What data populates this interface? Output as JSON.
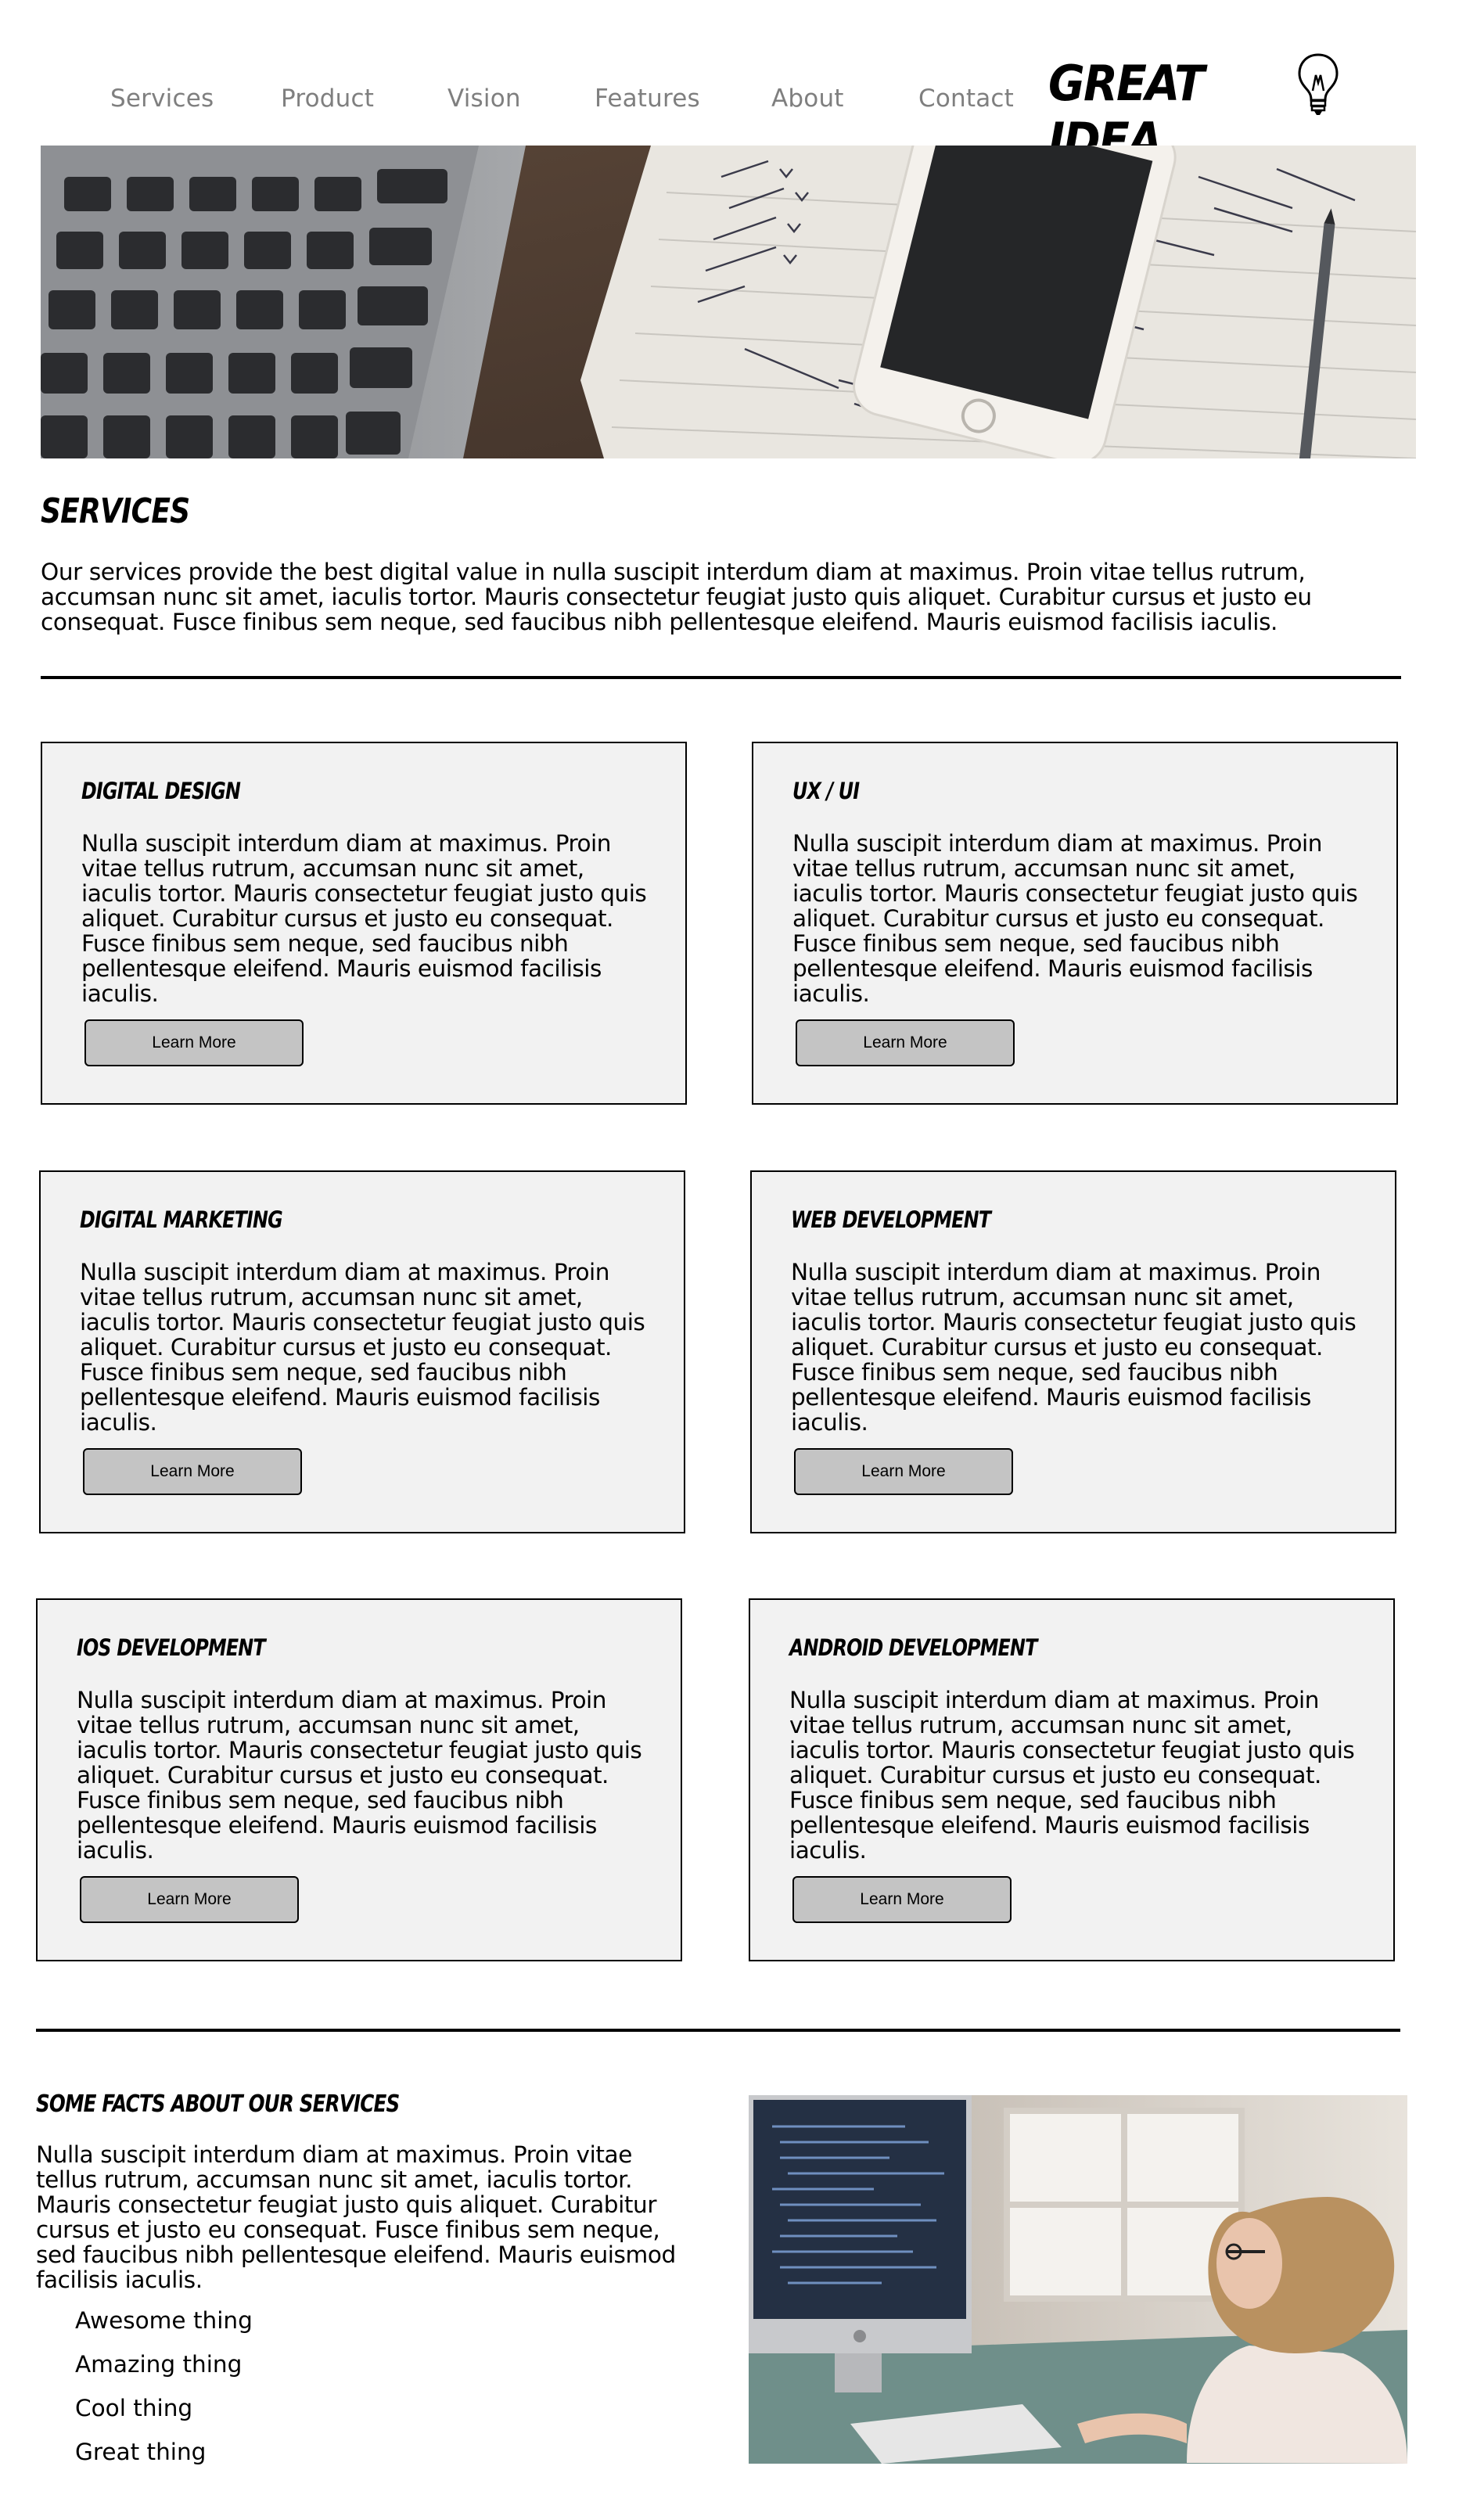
{
  "nav": {
    "items": [
      {
        "label": "Services"
      },
      {
        "label": "Product"
      },
      {
        "label": "Vision"
      },
      {
        "label": "Features"
      },
      {
        "label": "About"
      },
      {
        "label": "Contact"
      }
    ],
    "logo_text": "GREAT IDEA",
    "logo_icon": "lightbulb-icon"
  },
  "hero": {
    "image": "desk-laptop-phone-notebook-photo"
  },
  "services": {
    "title": "SERVICES",
    "intro": "Our services provide the best digital value in nulla suscipit interdum diam at maximus. Proin vitae tellus rutrum, accumsan nunc sit amet, iaculis tortor. Mauris consectetur feugiat justo quis aliquet. Curabitur cursus et justo eu consequat. Fusce finibus sem neque, sed faucibus nibh pellentesque eleifend. Mauris euismod facilisis iaculis.",
    "cards": [
      {
        "title": "DIGITAL DESIGN",
        "body": "Nulla suscipit interdum diam at maximus. Proin vitae tellus rutrum, accumsan nunc sit amet, iaculis tortor. Mauris consectetur feugiat justo quis aliquet. Curabitur cursus et justo eu consequat. Fusce finibus sem neque, sed faucibus nibh pellentesque eleifend. Mauris euismod facilisis iaculis.",
        "button": "Learn More"
      },
      {
        "title": "UX / UI",
        "body": "Nulla suscipit interdum diam at maximus. Proin vitae tellus rutrum, accumsan nunc sit amet, iaculis tortor. Mauris consectetur feugiat justo quis aliquet. Curabitur cursus et justo eu consequat. Fusce finibus sem neque, sed faucibus nibh pellentesque eleifend. Mauris euismod facilisis iaculis.",
        "button": "Learn More"
      },
      {
        "title": "DIGITAL MARKETING",
        "body": "Nulla suscipit interdum diam at maximus. Proin vitae tellus rutrum, accumsan nunc sit amet, iaculis tortor. Mauris consectetur feugiat justo quis aliquet. Curabitur cursus et justo eu consequat. Fusce finibus sem neque, sed faucibus nibh pellentesque eleifend. Mauris euismod facilisis iaculis.",
        "button": "Learn More"
      },
      {
        "title": "WEB DEVELOPMENT",
        "body": "Nulla suscipit interdum diam at maximus. Proin vitae tellus rutrum, accumsan nunc sit amet, iaculis tortor. Mauris consectetur feugiat justo quis aliquet. Curabitur cursus et justo eu consequat. Fusce finibus sem neque, sed faucibus nibh pellentesque eleifend. Mauris euismod facilisis iaculis.",
        "button": "Learn More"
      },
      {
        "title": "IOS DEVELOPMENT",
        "body": "Nulla suscipit interdum diam at maximus. Proin vitae tellus rutrum, accumsan nunc sit amet, iaculis tortor. Mauris consectetur feugiat justo quis aliquet. Curabitur cursus et justo eu consequat. Fusce finibus sem neque, sed faucibus nibh pellentesque eleifend. Mauris euismod facilisis iaculis.",
        "button": "Learn More"
      },
      {
        "title": "ANDROID DEVELOPMENT",
        "body": "Nulla suscipit interdum diam at maximus. Proin vitae tellus rutrum, accumsan nunc sit amet, iaculis tortor. Mauris consectetur feugiat justo quis aliquet. Curabitur cursus et justo eu consequat. Fusce finibus sem neque, sed faucibus nibh pellentesque eleifend. Mauris euismod facilisis iaculis.",
        "button": "Learn More"
      }
    ]
  },
  "facts": {
    "title": "SOME FACTS ABOUT OUR SERVICES",
    "body": "Nulla suscipit interdum diam at maximus. Proin vitae tellus rutrum, accumsan nunc sit amet, iaculis tortor. Mauris consectetur feugiat justo quis aliquet. Curabitur cursus et justo eu consequat. Fusce finibus sem neque, sed faucibus nibh pellentesque eleifend. Mauris euismod facilisis iaculis.",
    "list": [
      "Awesome thing",
      "Amazing thing",
      "Cool thing",
      "Great thing"
    ],
    "image": "woman-coding-at-computer-photo"
  },
  "colors": {
    "nav_text": "#7f7f7f",
    "card_bg": "#f2f2f2",
    "button_bg": "#c4c4c4",
    "border": "#000000"
  }
}
